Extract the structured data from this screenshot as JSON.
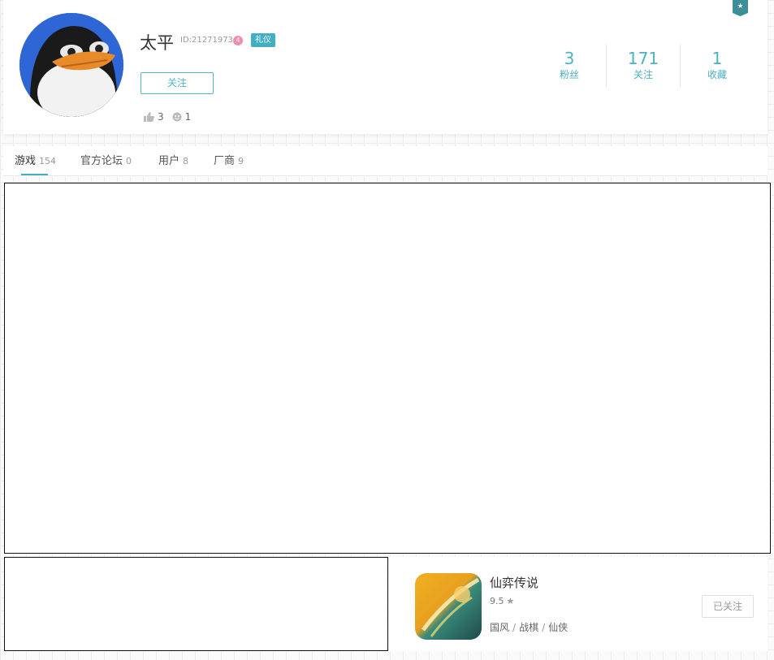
{
  "profile": {
    "name": "太平",
    "id_label": "ID:21271973",
    "level": "4",
    "tag": "礼仪",
    "follow_label": "关注",
    "likes": "3",
    "emoji_count": "1",
    "corner_badge_icon": "star-shield-icon",
    "accent_color": "#4bb2c4"
  },
  "stats": [
    {
      "value": "3",
      "label": "粉丝"
    },
    {
      "value": "171",
      "label": "关注"
    },
    {
      "value": "1",
      "label": "收藏"
    }
  ],
  "tabs": [
    {
      "label": "游戏",
      "count": "154"
    },
    {
      "label": "官方论坛",
      "count": "0"
    },
    {
      "label": "用户",
      "count": "8"
    },
    {
      "label": "厂商",
      "count": "9"
    }
  ],
  "game": {
    "title": "仙弈传说",
    "rating": "9.5",
    "tags": [
      "国风",
      "战棋",
      "仙侠"
    ],
    "followed_label": "已关注"
  }
}
